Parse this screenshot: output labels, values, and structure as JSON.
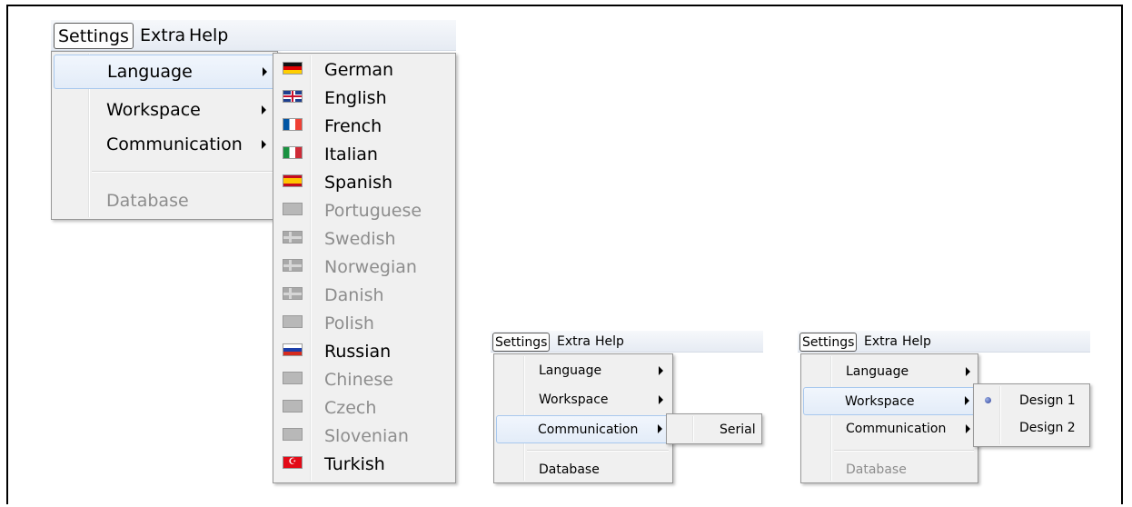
{
  "menubar": {
    "items": [
      "Settings",
      "Extra",
      "Help"
    ]
  },
  "settings_menu": {
    "items": [
      {
        "label": "Language",
        "submenu": true,
        "enabled": true
      },
      {
        "label": "Workspace",
        "submenu": true,
        "enabled": true
      },
      {
        "label": "Communication",
        "submenu": true,
        "enabled": true
      },
      {
        "label": "Database",
        "submenu": false,
        "enabled": false
      }
    ]
  },
  "language_submenu": {
    "items": [
      {
        "label": "German",
        "enabled": true,
        "flag": "flag-germany"
      },
      {
        "label": "English",
        "enabled": true,
        "flag": "flag-uk"
      },
      {
        "label": "French",
        "enabled": true,
        "flag": "flag-france"
      },
      {
        "label": "Italian",
        "enabled": true,
        "flag": "flag-italy"
      },
      {
        "label": "Spanish",
        "enabled": true,
        "flag": "flag-spain"
      },
      {
        "label": "Portuguese",
        "enabled": false,
        "flag": "flag-gray"
      },
      {
        "label": "Swedish",
        "enabled": false,
        "flag": "flag-nordic"
      },
      {
        "label": "Norwegian",
        "enabled": false,
        "flag": "flag-nordic"
      },
      {
        "label": "Danish",
        "enabled": false,
        "flag": "flag-nordic"
      },
      {
        "label": "Polish",
        "enabled": false,
        "flag": "flag-gray"
      },
      {
        "label": "Russian",
        "enabled": true,
        "flag": "flag-russia"
      },
      {
        "label": "Chinese",
        "enabled": false,
        "flag": "flag-gray"
      },
      {
        "label": "Czech",
        "enabled": false,
        "flag": "flag-gray"
      },
      {
        "label": "Slovenian",
        "enabled": false,
        "flag": "flag-gray"
      },
      {
        "label": "Turkish",
        "enabled": true,
        "flag": "flag-turkey"
      }
    ]
  },
  "communication_submenu": {
    "items": [
      "Serial"
    ]
  },
  "workspace_submenu": {
    "items": [
      "Design 1",
      "Design 2"
    ],
    "selected": "Design 1"
  },
  "colors": {
    "highlight_border": "#a8c8ee",
    "disabled_text": "#8d8d8d",
    "menu_bg": "#f0f0f0"
  }
}
